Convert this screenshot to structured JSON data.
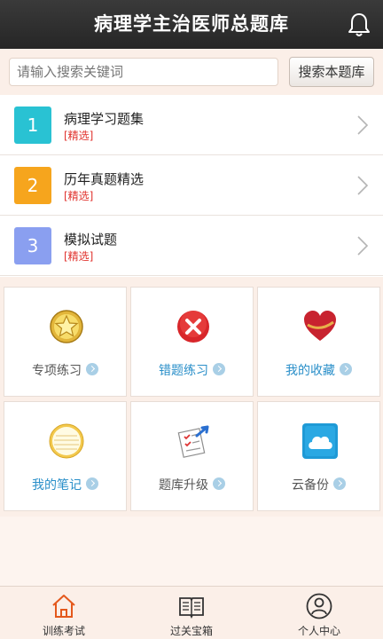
{
  "header": {
    "title": "病理学主治医师总题库",
    "bell_icon": "bell-icon"
  },
  "search": {
    "placeholder": "请输入搜索关键词",
    "button_label": "搜索本题库"
  },
  "list": {
    "items": [
      {
        "num": "1",
        "title": "病理学习题集",
        "tag": "[精选]",
        "color": "#29c2d3"
      },
      {
        "num": "2",
        "title": "历年真题精选",
        "tag": "[精选]",
        "color": "#f6a51d"
      },
      {
        "num": "3",
        "title": "模拟试题",
        "tag": "[精选]",
        "color": "#8a9ff0"
      }
    ]
  },
  "grid": {
    "tiles": [
      {
        "label": "专项练习",
        "icon": "star-medal-icon"
      },
      {
        "label": "错题练习",
        "icon": "error-x-icon"
      },
      {
        "label": "我的收藏",
        "icon": "heart-icon"
      },
      {
        "label": "我的笔记",
        "icon": "notepad-icon"
      },
      {
        "label": "题库升级",
        "icon": "checklist-upgrade-icon"
      },
      {
        "label": "云备份",
        "icon": "cloud-icon"
      }
    ]
  },
  "bottom_nav": {
    "items": [
      {
        "label": "训练考试",
        "icon": "home-icon",
        "active": true
      },
      {
        "label": "过关宝箱",
        "icon": "book-icon"
      },
      {
        "label": "个人中心",
        "icon": "user-icon"
      }
    ]
  },
  "colors": {
    "active_nav": "#e4581c",
    "accent_blue": "#2a8fc9"
  }
}
